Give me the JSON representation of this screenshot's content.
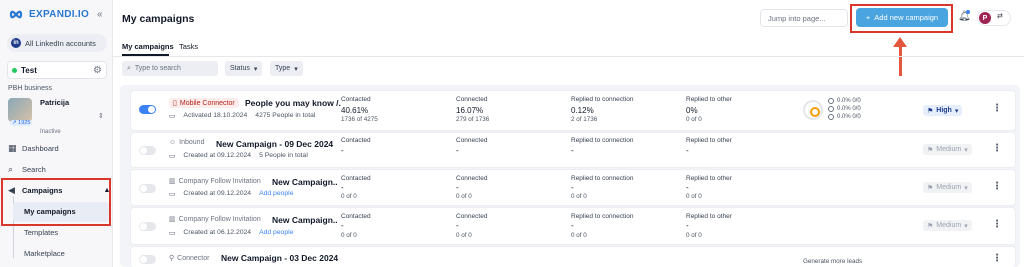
{
  "brand": {
    "name": "EXPANDI.IO",
    "collapse_icon": "«"
  },
  "sidebar": {
    "accounts_button": "All LinkedIn accounts",
    "workspace": "Test",
    "business": "PBH business",
    "profile": {
      "name": "Patricija",
      "badge": "↗ 1925",
      "status": "Inactive"
    },
    "nav": {
      "dashboard": "Dashboard",
      "search": "Search",
      "campaigns": "Campaigns"
    },
    "sub": {
      "my_campaigns": "My campaigns",
      "templates": "Templates",
      "marketplace": "Marketplace"
    }
  },
  "header": {
    "title": "My campaigns",
    "jump_placeholder": "Jump into page...",
    "add_button": "Add new campaign",
    "user_initial": "P"
  },
  "tabs": {
    "my_campaigns": "My campaigns",
    "tasks": "Tasks"
  },
  "filters": {
    "search_placeholder": "Type to search",
    "status": "Status",
    "type": "Type"
  },
  "campaigns": [
    {
      "type": "Mobile Connector",
      "name": "People you may know /...",
      "date_label": "Activated 18.10.2024",
      "people": "4275 People in total",
      "contacted": {
        "label": "Contacted",
        "value": "40.61%",
        "sub": "1736 of 4275"
      },
      "connected": {
        "label": "Connected",
        "value": "16.07%",
        "sub": "279 of 1736"
      },
      "replied_conn": {
        "label": "Replied to connection",
        "value": "0.12%",
        "sub": "2 of 1736"
      },
      "replied_other": {
        "label": "Replied to other",
        "value": "0%",
        "sub": "0 of 0"
      },
      "mini": [
        "0.0% 0/0",
        "0.0% 0/0",
        "0.0% 0/0"
      ],
      "priority": "High"
    },
    {
      "type": "Inbound",
      "name": "New Campaign - 09 Dec 2024",
      "date_label": "Created at 09.12.2024",
      "people": "5 People in total",
      "contacted": {
        "label": "Contacted",
        "value": "-",
        "sub": ""
      },
      "connected": {
        "label": "Connected",
        "value": "-",
        "sub": ""
      },
      "replied_conn": {
        "label": "Replied to connection",
        "value": "-",
        "sub": ""
      },
      "replied_other": {
        "label": "Replied to other",
        "value": "-",
        "sub": ""
      },
      "priority": "Medium"
    },
    {
      "type": "Company Follow Invitation",
      "name": "New Campaign...",
      "date_label": "Created at 09.12.2024",
      "people": "Add people",
      "contacted": {
        "label": "Contacted",
        "value": "-",
        "sub": "0 of 0"
      },
      "connected": {
        "label": "Connected",
        "value": "-",
        "sub": "0 of 0"
      },
      "replied_conn": {
        "label": "Replied to connection",
        "value": "-",
        "sub": "0 of 0"
      },
      "replied_other": {
        "label": "Replied to other",
        "value": "-",
        "sub": "0 of 0"
      },
      "priority": "Medium"
    },
    {
      "type": "Company Follow Invitation",
      "name": "New Campaign...",
      "date_label": "Created at 06.12.2024",
      "people": "Add people",
      "contacted": {
        "label": "Contacted",
        "value": "-",
        "sub": "0 of 0"
      },
      "connected": {
        "label": "Connected",
        "value": "-",
        "sub": "0 of 0"
      },
      "replied_conn": {
        "label": "Replied to connection",
        "value": "-",
        "sub": "0 of 0"
      },
      "replied_other": {
        "label": "Replied to other",
        "value": "-",
        "sub": "0 of 0"
      },
      "priority": "Medium"
    },
    {
      "type": "Connector",
      "name": "New Campaign - 03 Dec 2024",
      "extra": "Generate more leads"
    }
  ],
  "colors": {
    "primary": "#4aa4df",
    "highlight": "#d9372b",
    "arrow": "#e4563e"
  }
}
